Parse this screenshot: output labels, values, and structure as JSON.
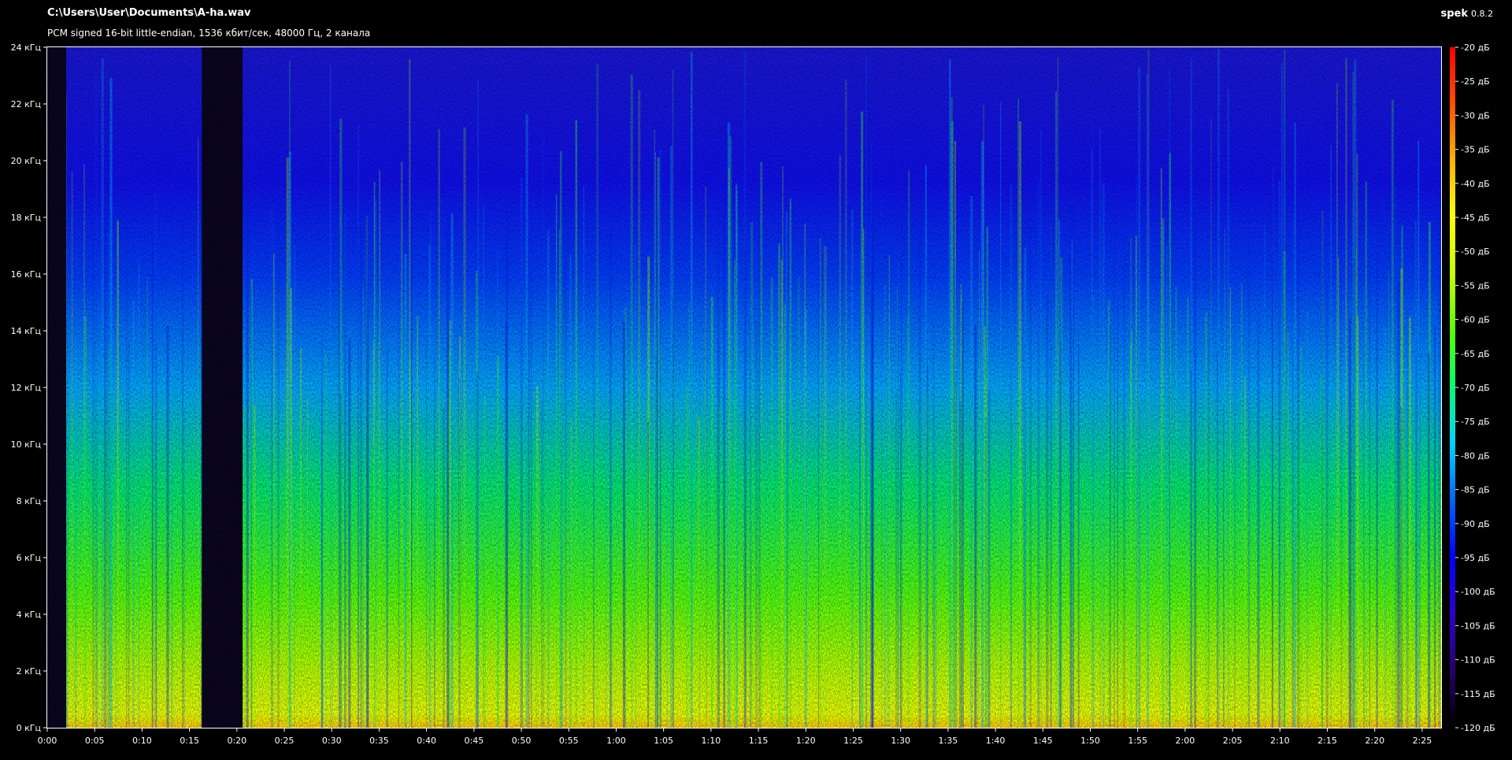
{
  "header": {
    "file_path": "C:\\Users\\User\\Documents\\A-ha.wav",
    "file_info": "PCM signed 16-bit little-endian, 1536 кбит/сек, 48000 Гц, 2 канала",
    "app_name": "spek",
    "app_version": "0.8.2"
  },
  "chart_data": {
    "type": "heatmap",
    "x_unit": "seconds",
    "xlim": [
      0,
      147
    ],
    "ylim": [
      0,
      24
    ],
    "colorbar_lim": [
      -120,
      -20
    ],
    "x_ticks": [
      "0:00",
      "0:05",
      "0:10",
      "0:15",
      "0:20",
      "0:25",
      "0:30",
      "0:35",
      "0:40",
      "0:45",
      "0:50",
      "0:55",
      "1:00",
      "1:05",
      "1:10",
      "1:15",
      "1:20",
      "1:25",
      "1:30",
      "1:35",
      "1:40",
      "1:45",
      "1:50",
      "1:55",
      "2:00",
      "2:05",
      "2:10",
      "2:15",
      "2:20",
      "2:25"
    ],
    "x_tick_seconds": [
      0,
      5,
      10,
      15,
      20,
      25,
      30,
      35,
      40,
      45,
      50,
      55,
      60,
      65,
      70,
      75,
      80,
      85,
      90,
      95,
      100,
      105,
      110,
      115,
      120,
      125,
      130,
      135,
      140,
      145
    ],
    "y_ticks": [
      "0 кГц",
      "2 кГц",
      "4 кГц",
      "6 кГц",
      "8 кГц",
      "10 кГц",
      "12 кГц",
      "14 кГц",
      "16 кГц",
      "18 кГц",
      "20 кГц",
      "22 кГц",
      "24 кГц"
    ],
    "y_tick_khz": [
      0,
      2,
      4,
      6,
      8,
      10,
      12,
      14,
      16,
      18,
      20,
      22,
      24
    ],
    "db_ticks": [
      "-20 дБ",
      "-25 дБ",
      "-30 дБ",
      "-35 дБ",
      "-40 дБ",
      "-45 дБ",
      "-50 дБ",
      "-55 дБ",
      "-60 дБ",
      "-65 дБ",
      "-70 дБ",
      "-75 дБ",
      "-80 дБ",
      "-85 дБ",
      "-90 дБ",
      "-95 дБ",
      "-100 дБ",
      "-105 дБ",
      "-110 дБ",
      "-115 дБ",
      "-120 дБ"
    ],
    "db_tick_values": [
      -20,
      -25,
      -30,
      -35,
      -40,
      -45,
      -50,
      -55,
      -60,
      -65,
      -70,
      -75,
      -80,
      -85,
      -90,
      -95,
      -100,
      -105,
      -110,
      -115,
      -120
    ],
    "silent_spans_seconds": [
      [
        0,
        2
      ],
      [
        16.3,
        20.6
      ]
    ],
    "colors": {
      "scale": [
        "#000000",
        "#24006b",
        "#3000c8",
        "#0000ff",
        "#0064ff",
        "#00d2ff",
        "#00ff78",
        "#5aff00",
        "#c8ff00",
        "#ffff00",
        "#ffb400",
        "#ff5000",
        "#ff0000"
      ],
      "silence": "#0b0620"
    }
  }
}
